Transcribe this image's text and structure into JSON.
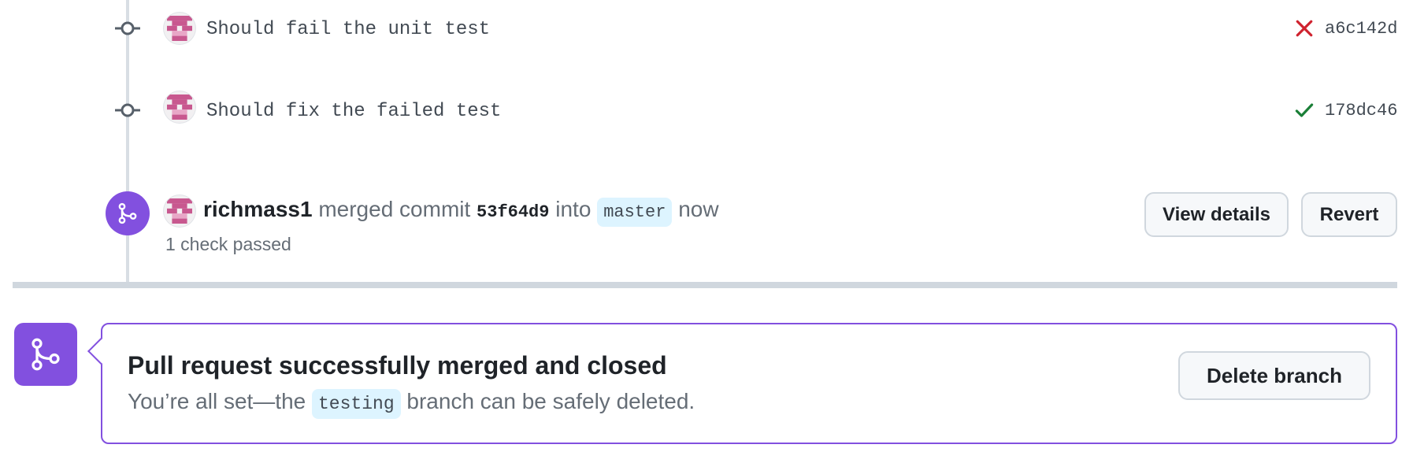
{
  "commits": [
    {
      "message": "Should fail the unit test",
      "sha": "a6c142d",
      "status": "failure",
      "status_color": "#cf222e"
    },
    {
      "message": "Should fix the failed test",
      "sha": "178dc46",
      "status": "success",
      "status_color": "#1a7f37"
    }
  ],
  "merge_event": {
    "user": "richmass1",
    "action_text": "merged commit",
    "commit_sha": "53f64d9",
    "into_text": "into",
    "target_branch": "master",
    "time": "now",
    "checks": "1 check passed",
    "buttons": {
      "view_details": "View details",
      "revert": "Revert"
    }
  },
  "merged_banner": {
    "title": "Pull request successfully merged and closed",
    "sub_prefix": "You’re all set—the",
    "branch": "testing",
    "sub_suffix": "branch can be safely deleted.",
    "delete_button": "Delete branch"
  },
  "colors": {
    "merged_purple": "#8250df",
    "divider": "#d0d7de",
    "branch_bg": "#ddf4ff"
  },
  "icons": [
    "git-commit-icon",
    "x-icon",
    "check-icon",
    "git-merge-icon",
    "avatar-identicon"
  ]
}
